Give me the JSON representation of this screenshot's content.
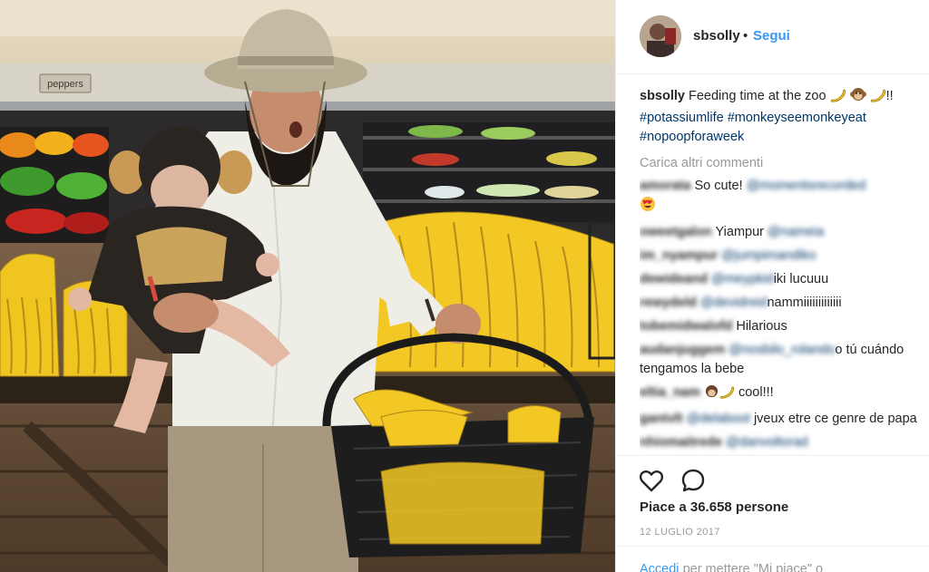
{
  "photo": {
    "shelf_sign": "peppers",
    "description_icon": "photo"
  },
  "post": {
    "username": "sbsolly",
    "separator": "•",
    "follow_label": "Segui",
    "caption_user": "sbsolly",
    "caption_text": "Feeding time at the zoo",
    "caption_suffix": "!!",
    "hashtags": [
      "#potassiumlife",
      "#monkeyseemonkeyeat",
      "#nopoopforaweek"
    ],
    "load_more": "Carica altri commenti",
    "likes": "Piace a 36.658 persone",
    "date": "12 LUGLIO 2017",
    "login_link": "Accedi",
    "login_text": "per mettere \"Mi piace\" o"
  },
  "comments": [
    {
      "text": "So cute!"
    },
    {
      "text": "Yiampur"
    },
    {
      "text": "iki lucuuu"
    },
    {
      "text": "nammiiiiiiiiiiiii"
    },
    {
      "text": "Hilarious"
    },
    {
      "text": "o tú cuándo tengamos la bebe"
    },
    {
      "text": "cool!!!"
    },
    {
      "text": "jveux etre ce genre de papa"
    }
  ],
  "colors": {
    "link": "#3897f0",
    "hashtag": "#003569",
    "muted": "#999999",
    "text": "#262626"
  },
  "icons": [
    "heart-icon",
    "comment-icon",
    "avatar"
  ]
}
